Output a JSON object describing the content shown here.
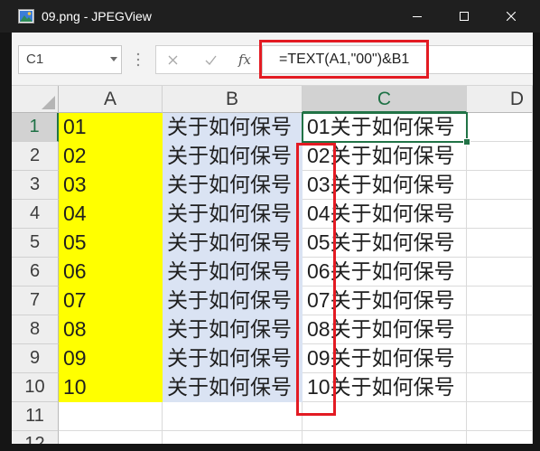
{
  "window": {
    "title": "09.png - JPEGView"
  },
  "icons": {
    "app": "jpegview-app-icon",
    "minimize": "minimize-icon",
    "maximize": "maximize-icon",
    "close": "close-icon",
    "name_box_dropdown": "chevron-down-icon",
    "more_options": "vertical-dots-icon",
    "cancel": "cancel-x-icon",
    "enter": "checkmark-icon",
    "corner": "select-all-triangle-icon"
  },
  "formula_bar": {
    "name_box": "C1",
    "fx_label": "fx",
    "formula": "=TEXT(A1,\"00\")&B1"
  },
  "sheet": {
    "columns": [
      "A",
      "B",
      "C",
      "D"
    ],
    "rows": [
      {
        "header": "1",
        "a": "01",
        "b": "关于如何保号",
        "c": "01关于如何保号"
      },
      {
        "header": "2",
        "a": "02",
        "b": "关于如何保号",
        "c": "02关于如何保号"
      },
      {
        "header": "3",
        "a": "03",
        "b": "关于如何保号",
        "c": "03关于如何保号"
      },
      {
        "header": "4",
        "a": "04",
        "b": "关于如何保号",
        "c": "04关于如何保号"
      },
      {
        "header": "5",
        "a": "05",
        "b": "关于如何保号",
        "c": "05关于如何保号"
      },
      {
        "header": "6",
        "a": "06",
        "b": "关于如何保号",
        "c": "06关于如何保号"
      },
      {
        "header": "7",
        "a": "07",
        "b": "关于如何保号",
        "c": "07关于如何保号"
      },
      {
        "header": "8",
        "a": "08",
        "b": "关于如何保号",
        "c": "08关于如何保号"
      },
      {
        "header": "9",
        "a": "09",
        "b": "关于如何保号",
        "c": "09关于如何保号"
      },
      {
        "header": "10",
        "a": "10",
        "b": "关于如何保号",
        "c": "10关于如何保号"
      },
      {
        "header": "11"
      },
      {
        "header": "12"
      }
    ]
  },
  "colors": {
    "title_bar": "#1f1f1f",
    "column_a_fill": "#ffff00",
    "column_b_fill": "#dae3f3",
    "selection_green": "#217346",
    "annotation_red": "#e31b23"
  }
}
